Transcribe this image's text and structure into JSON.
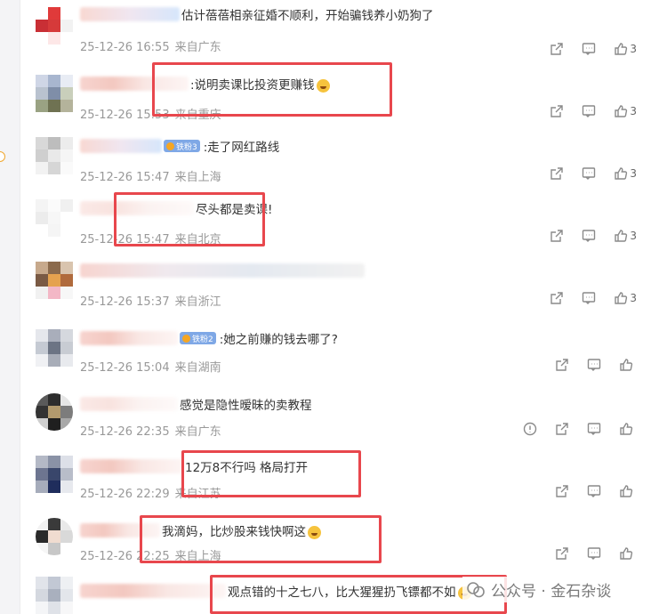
{
  "comments": [
    {
      "text": "估计蓓蓓相亲征婚不顺利，开始骗钱养小奶狗了",
      "date": "25-12-26 16:55",
      "location": "来自广东",
      "likes": "3",
      "badge": "",
      "has_emoji": false
    },
    {
      "text": "说明卖课比投资更赚钱",
      "date": "25-12-26 15:53",
      "location": "来自重庆",
      "likes": "3",
      "badge": "",
      "has_emoji": true
    },
    {
      "text": ":走了网红路线",
      "date": "25-12-26 15:47",
      "location": "来自上海",
      "likes": "3",
      "badge": "铁粉3",
      "has_emoji": false
    },
    {
      "text": "尽头都是卖课!",
      "date": "25-12-26 15:47",
      "location": "来自北京",
      "likes": "3",
      "badge": "",
      "has_emoji": false
    },
    {
      "text": "",
      "date": "25-12-26 15:37",
      "location": "来自浙江",
      "likes": "3",
      "badge": "",
      "has_emoji": false
    },
    {
      "text": ":她之前赚的钱去哪了?",
      "date": "25-12-26 15:04",
      "location": "来自湖南",
      "likes": "",
      "badge": "铁粉2",
      "has_emoji": false
    },
    {
      "text": "感觉是隐性暧昧的卖教程",
      "date": "25-12-26 22:35",
      "location": "来自广东",
      "likes": "",
      "badge": "",
      "has_emoji": false
    },
    {
      "text": "12万8不行吗  格局打开",
      "date": "25-12-26 22:29",
      "location": "来自江苏",
      "likes": "",
      "badge": "",
      "has_emoji": false
    },
    {
      "text": "我滴妈，比炒股来钱快啊这",
      "date": "25-12-26 22:25",
      "location": "来自上海",
      "likes": "",
      "badge": "",
      "has_emoji": true
    },
    {
      "text": "观点错的十之七八，比大猩猩扔飞镖都不如",
      "date": "",
      "location": "",
      "likes": "",
      "badge": "",
      "has_emoji": true
    }
  ],
  "icons": {
    "share": "share-icon",
    "comment": "comment-icon",
    "like": "thumb-up-icon",
    "report": "report-icon"
  },
  "watermark": {
    "text": "公众号 · 金石杂谈"
  },
  "colors": {
    "highlight_box": "#e8474d",
    "meta_text": "#999999",
    "badge_bg": "#7fa8e6"
  }
}
